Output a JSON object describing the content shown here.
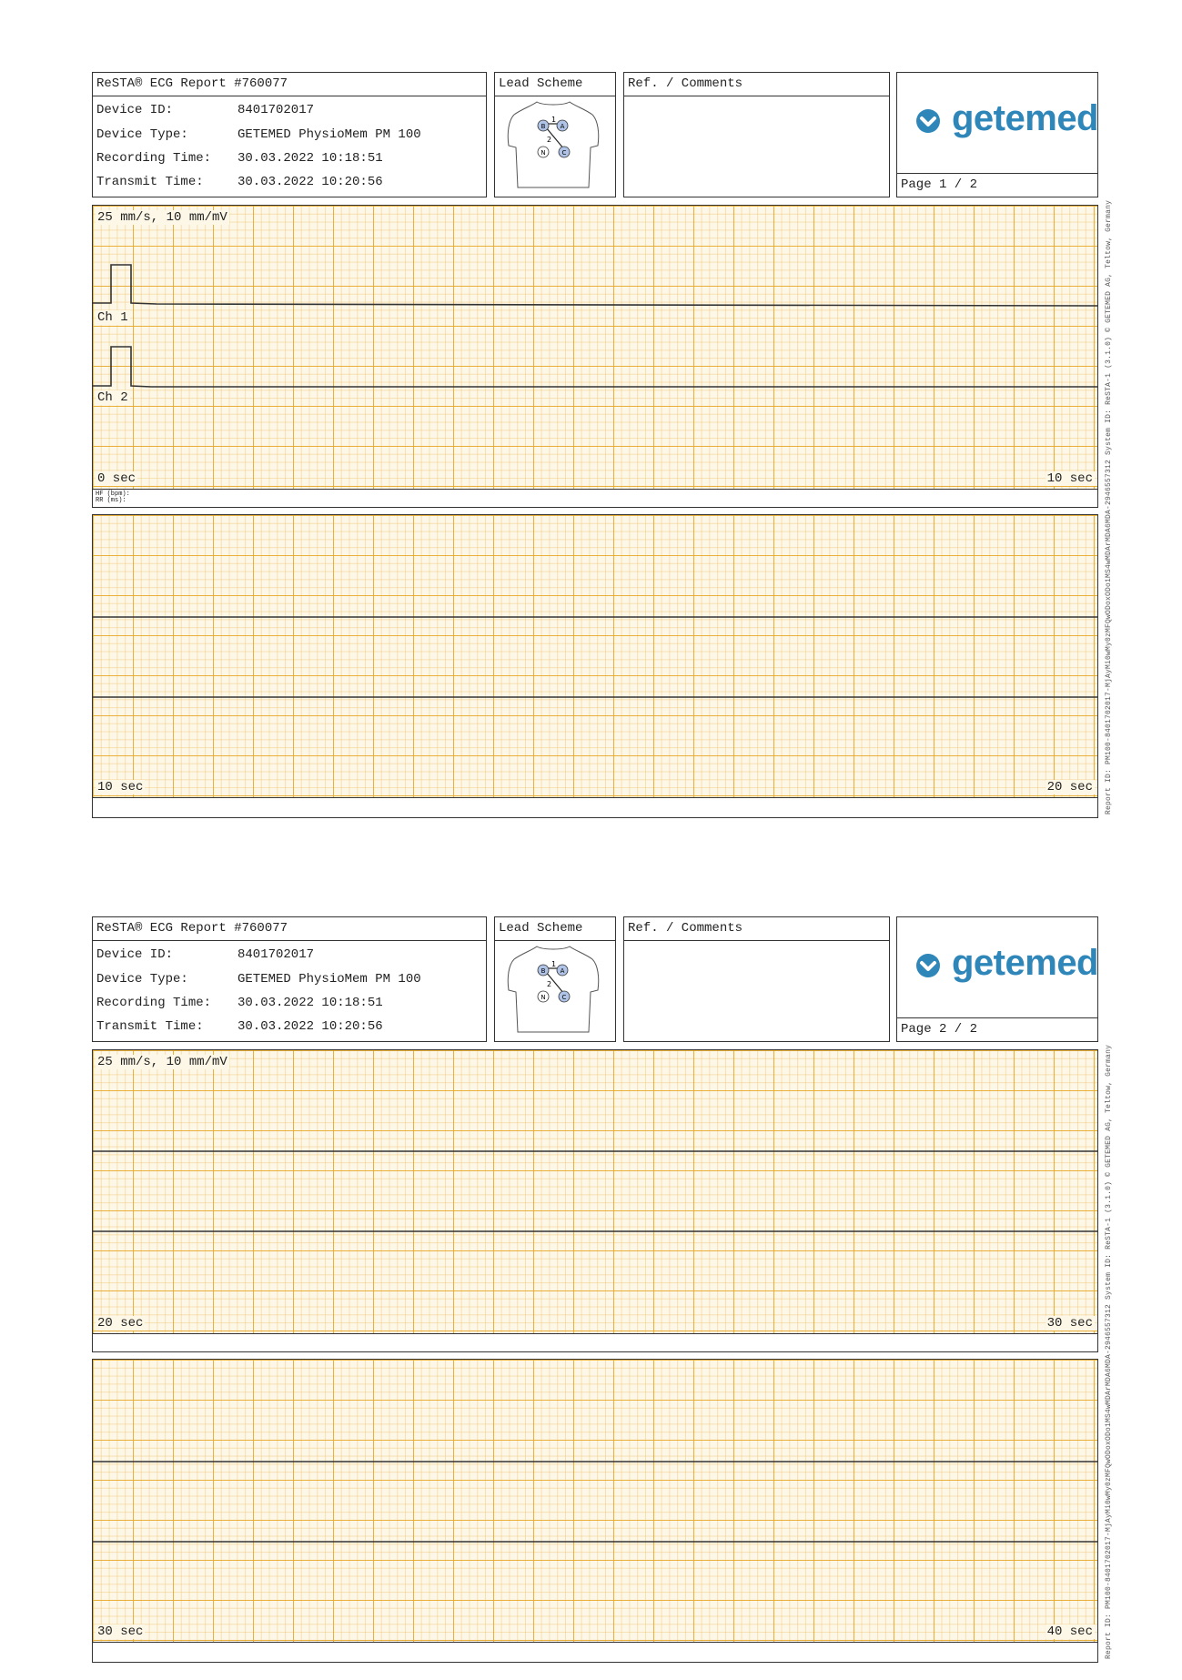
{
  "pages": [
    {
      "header": {
        "title": "ReSTA® ECG Report #760077",
        "device_id_label": "Device ID:",
        "device_id": "8401702017",
        "device_type_label": "Device Type:",
        "device_type": "GETEMED PhysioMem PM 100",
        "recording_time_label": "Recording Time:",
        "recording_time": "30.03.2022 10:18:51",
        "transmit_time_label": "Transmit Time:",
        "transmit_time": "30.03.2022 10:20:56",
        "lead_scheme_label": "Lead Scheme",
        "comments_label": "Ref. / Comments",
        "logo_text": "getemed",
        "page_label": "Page 1 / 2"
      },
      "strips": [
        {
          "scale": "25 mm/s, 10 mm/mV",
          "ch1": "Ch 1",
          "ch2": "Ch 2",
          "start": "0 sec",
          "end": "10 sec",
          "hf": "HF (bpm):",
          "rr": "RR (ms):"
        },
        {
          "start": "10 sec",
          "end": "20 sec"
        }
      ]
    },
    {
      "header": {
        "title": "ReSTA® ECG Report #760077",
        "device_id_label": "Device ID:",
        "device_id": "8401702017",
        "device_type_label": "Device Type:",
        "device_type": "GETEMED PhysioMem PM 100",
        "recording_time_label": "Recording Time:",
        "recording_time": "30.03.2022 10:18:51",
        "transmit_time_label": "Transmit Time:",
        "transmit_time": "30.03.2022 10:20:56",
        "lead_scheme_label": "Lead Scheme",
        "comments_label": "Ref. / Comments",
        "logo_text": "getemed",
        "page_label": "Page 2 / 2"
      },
      "strips": [
        {
          "scale": "25 mm/s, 10 mm/mV",
          "start": "20 sec",
          "end": "30 sec"
        },
        {
          "start": "30 sec",
          "end": "40 sec"
        }
      ]
    }
  ],
  "lead_markers": [
    "B",
    "A",
    "N",
    "C",
    "1",
    "2"
  ],
  "side_text": {
    "upper": "Report ID: PM100-8401702017-MjAyMi0wMy0zMFQwODoxODo1MS4wMDArMDA6MDA-2946557312   System ID: ReSTA-1 (3.1.0)  © GETEMED AG, Teltow, Germany"
  },
  "colors": {
    "grid_major": "#e8a828",
    "grid_minor": "#eec36e",
    "paper": "#fdf7e7",
    "logo": "#2e86b9",
    "lead_marker": "#aec3e6"
  }
}
